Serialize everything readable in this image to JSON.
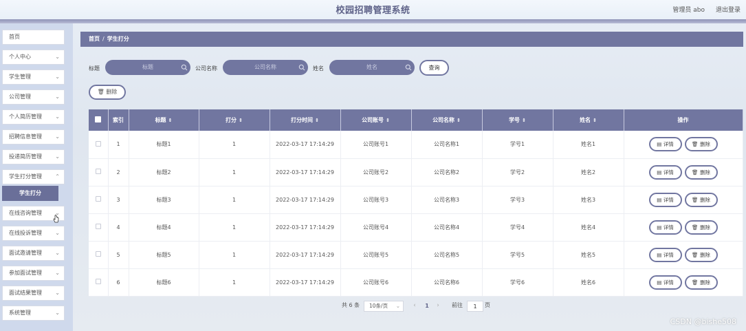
{
  "header": {
    "title": "校园招聘管理系统",
    "user": "管理员 abo",
    "logout": "退出登录"
  },
  "sidebar": {
    "items": [
      {
        "label": "首页",
        "has_chevron": false
      },
      {
        "label": "个人中心",
        "has_chevron": true
      },
      {
        "label": "学生管理",
        "has_chevron": true
      },
      {
        "label": "公司管理",
        "has_chevron": true
      },
      {
        "label": "个人简历管理",
        "has_chevron": true
      },
      {
        "label": "招聘信息管理",
        "has_chevron": true
      },
      {
        "label": "投递简历管理",
        "has_chevron": true
      },
      {
        "label": "学生打分管理",
        "has_chevron": true
      },
      {
        "label": "在线咨询管理",
        "has_chevron": true
      },
      {
        "label": "在线投诉管理",
        "has_chevron": true
      },
      {
        "label": "面试邀请管理",
        "has_chevron": true
      },
      {
        "label": "参加面试管理",
        "has_chevron": true
      },
      {
        "label": "面试结果管理",
        "has_chevron": true
      },
      {
        "label": "系统管理",
        "has_chevron": true
      }
    ],
    "active_submenu": "学生打分"
  },
  "breadcrumb": {
    "home": "首页",
    "separator": "/",
    "current": "学生打分"
  },
  "filters": {
    "title_label": "标题",
    "title_placeholder": "标题",
    "company_label": "公司名称",
    "company_placeholder": "公司名称",
    "name_label": "姓名",
    "name_placeholder": "姓名",
    "query_button": "查询"
  },
  "actions": {
    "delete_button": "删除"
  },
  "table": {
    "headers": {
      "index": "索引",
      "title": "标题",
      "score": "打分",
      "time": "打分时间",
      "account": "公司账号",
      "company": "公司名称",
      "student_no": "学号",
      "name": "姓名",
      "ops": "操作"
    },
    "sort_icon": "sort-icon",
    "row_buttons": {
      "detail": "详情",
      "delete": "删除"
    },
    "rows": [
      {
        "index": "1",
        "title": "标题1",
        "score": "1",
        "time": "2022-03-17 17:14:29",
        "account": "公司账号1",
        "company": "公司名称1",
        "student_no": "学号1",
        "name": "姓名1"
      },
      {
        "index": "2",
        "title": "标题2",
        "score": "1",
        "time": "2022-03-17 17:14:29",
        "account": "公司账号2",
        "company": "公司名称2",
        "student_no": "学号2",
        "name": "姓名2"
      },
      {
        "index": "3",
        "title": "标题3",
        "score": "1",
        "time": "2022-03-17 17:14:29",
        "account": "公司账号3",
        "company": "公司名称3",
        "student_no": "学号3",
        "name": "姓名3"
      },
      {
        "index": "4",
        "title": "标题4",
        "score": "1",
        "time": "2022-03-17 17:14:29",
        "account": "公司账号4",
        "company": "公司名称4",
        "student_no": "学号4",
        "name": "姓名4"
      },
      {
        "index": "5",
        "title": "标题5",
        "score": "1",
        "time": "2022-03-17 17:14:29",
        "account": "公司账号5",
        "company": "公司名称5",
        "student_no": "学号5",
        "name": "姓名5"
      },
      {
        "index": "6",
        "title": "标题6",
        "score": "1",
        "time": "2022-03-17 17:14:29",
        "account": "公司账号6",
        "company": "公司名称6",
        "student_no": "学号6",
        "name": "姓名6"
      }
    ]
  },
  "pagination": {
    "total": "共 6 条",
    "page_size": "10条/页",
    "prev": "‹",
    "current_page": "1",
    "next": "›",
    "goto_label": "前往",
    "goto_value": "1",
    "page_unit": "页"
  },
  "watermark": "CSDN @bishe508",
  "colors": {
    "primary": "#7176a0",
    "sidebar_bg": "#cfd9ec"
  }
}
